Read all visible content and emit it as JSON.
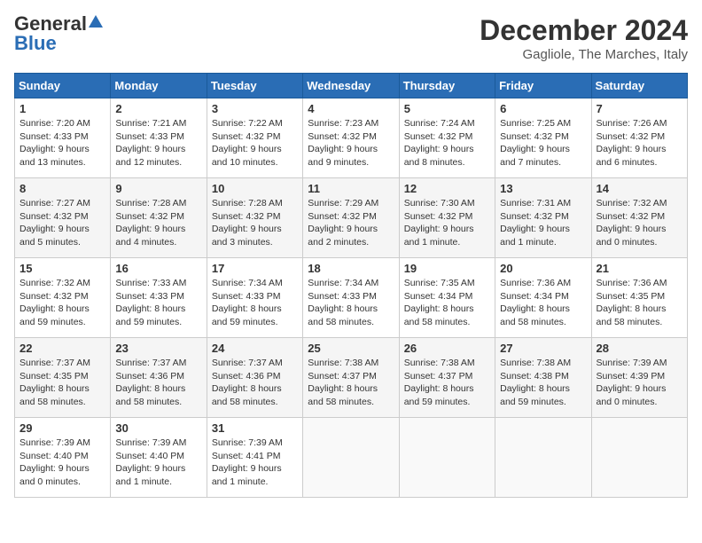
{
  "logo": {
    "general": "General",
    "blue": "Blue"
  },
  "title": "December 2024",
  "subtitle": "Gagliole, The Marches, Italy",
  "days_header": [
    "Sunday",
    "Monday",
    "Tuesday",
    "Wednesday",
    "Thursday",
    "Friday",
    "Saturday"
  ],
  "weeks": [
    [
      {
        "day": "1",
        "sunrise": "7:20 AM",
        "sunset": "4:33 PM",
        "daylight": "9 hours and 13 minutes."
      },
      {
        "day": "2",
        "sunrise": "7:21 AM",
        "sunset": "4:33 PM",
        "daylight": "9 hours and 12 minutes."
      },
      {
        "day": "3",
        "sunrise": "7:22 AM",
        "sunset": "4:32 PM",
        "daylight": "9 hours and 10 minutes."
      },
      {
        "day": "4",
        "sunrise": "7:23 AM",
        "sunset": "4:32 PM",
        "daylight": "9 hours and 9 minutes."
      },
      {
        "day": "5",
        "sunrise": "7:24 AM",
        "sunset": "4:32 PM",
        "daylight": "9 hours and 8 minutes."
      },
      {
        "day": "6",
        "sunrise": "7:25 AM",
        "sunset": "4:32 PM",
        "daylight": "9 hours and 7 minutes."
      },
      {
        "day": "7",
        "sunrise": "7:26 AM",
        "sunset": "4:32 PM",
        "daylight": "9 hours and 6 minutes."
      }
    ],
    [
      {
        "day": "8",
        "sunrise": "7:27 AM",
        "sunset": "4:32 PM",
        "daylight": "9 hours and 5 minutes."
      },
      {
        "day": "9",
        "sunrise": "7:28 AM",
        "sunset": "4:32 PM",
        "daylight": "9 hours and 4 minutes."
      },
      {
        "day": "10",
        "sunrise": "7:28 AM",
        "sunset": "4:32 PM",
        "daylight": "9 hours and 3 minutes."
      },
      {
        "day": "11",
        "sunrise": "7:29 AM",
        "sunset": "4:32 PM",
        "daylight": "9 hours and 2 minutes."
      },
      {
        "day": "12",
        "sunrise": "7:30 AM",
        "sunset": "4:32 PM",
        "daylight": "9 hours and 1 minute."
      },
      {
        "day": "13",
        "sunrise": "7:31 AM",
        "sunset": "4:32 PM",
        "daylight": "9 hours and 1 minute."
      },
      {
        "day": "14",
        "sunrise": "7:32 AM",
        "sunset": "4:32 PM",
        "daylight": "9 hours and 0 minutes."
      }
    ],
    [
      {
        "day": "15",
        "sunrise": "7:32 AM",
        "sunset": "4:32 PM",
        "daylight": "8 hours and 59 minutes."
      },
      {
        "day": "16",
        "sunrise": "7:33 AM",
        "sunset": "4:33 PM",
        "daylight": "8 hours and 59 minutes."
      },
      {
        "day": "17",
        "sunrise": "7:34 AM",
        "sunset": "4:33 PM",
        "daylight": "8 hours and 59 minutes."
      },
      {
        "day": "18",
        "sunrise": "7:34 AM",
        "sunset": "4:33 PM",
        "daylight": "8 hours and 58 minutes."
      },
      {
        "day": "19",
        "sunrise": "7:35 AM",
        "sunset": "4:34 PM",
        "daylight": "8 hours and 58 minutes."
      },
      {
        "day": "20",
        "sunrise": "7:36 AM",
        "sunset": "4:34 PM",
        "daylight": "8 hours and 58 minutes."
      },
      {
        "day": "21",
        "sunrise": "7:36 AM",
        "sunset": "4:35 PM",
        "daylight": "8 hours and 58 minutes."
      }
    ],
    [
      {
        "day": "22",
        "sunrise": "7:37 AM",
        "sunset": "4:35 PM",
        "daylight": "8 hours and 58 minutes."
      },
      {
        "day": "23",
        "sunrise": "7:37 AM",
        "sunset": "4:36 PM",
        "daylight": "8 hours and 58 minutes."
      },
      {
        "day": "24",
        "sunrise": "7:37 AM",
        "sunset": "4:36 PM",
        "daylight": "8 hours and 58 minutes."
      },
      {
        "day": "25",
        "sunrise": "7:38 AM",
        "sunset": "4:37 PM",
        "daylight": "8 hours and 58 minutes."
      },
      {
        "day": "26",
        "sunrise": "7:38 AM",
        "sunset": "4:37 PM",
        "daylight": "8 hours and 59 minutes."
      },
      {
        "day": "27",
        "sunrise": "7:38 AM",
        "sunset": "4:38 PM",
        "daylight": "8 hours and 59 minutes."
      },
      {
        "day": "28",
        "sunrise": "7:39 AM",
        "sunset": "4:39 PM",
        "daylight": "9 hours and 0 minutes."
      }
    ],
    [
      {
        "day": "29",
        "sunrise": "7:39 AM",
        "sunset": "4:40 PM",
        "daylight": "9 hours and 0 minutes."
      },
      {
        "day": "30",
        "sunrise": "7:39 AM",
        "sunset": "4:40 PM",
        "daylight": "9 hours and 1 minute."
      },
      {
        "day": "31",
        "sunrise": "7:39 AM",
        "sunset": "4:41 PM",
        "daylight": "9 hours and 1 minute."
      },
      null,
      null,
      null,
      null
    ]
  ]
}
